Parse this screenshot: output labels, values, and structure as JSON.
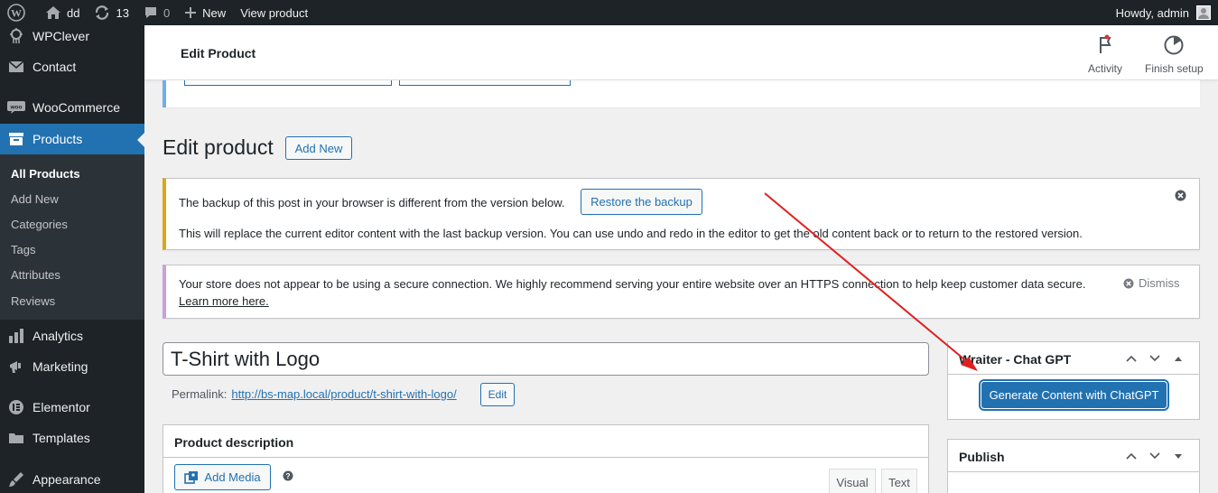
{
  "adminbar": {
    "site_name": "dd",
    "updates_count": "13",
    "comments_count": "0",
    "new_label": "New",
    "view_product_label": "View product",
    "howdy_label": "Howdy, admin"
  },
  "sidebar": {
    "items": [
      {
        "label": "WPClever",
        "icon": "wpclever-icon"
      },
      {
        "label": "Contact",
        "icon": "envelope-icon"
      },
      {
        "label": "WooCommerce",
        "icon": "woocommerce-icon"
      },
      {
        "label": "Products",
        "icon": "archive-box-icon"
      },
      {
        "label": "Analytics",
        "icon": "bar-chart-icon"
      },
      {
        "label": "Marketing",
        "icon": "megaphone-icon"
      },
      {
        "label": "Elementor",
        "icon": "elementor-icon"
      },
      {
        "label": "Templates",
        "icon": "folder-icon"
      },
      {
        "label": "Appearance",
        "icon": "paintbrush-icon"
      }
    ],
    "submenu": [
      "All Products",
      "Add New",
      "Categories",
      "Tags",
      "Attributes",
      "Reviews"
    ]
  },
  "header": {
    "title": "Edit Product",
    "activity_label": "Activity",
    "finish_setup_label": "Finish setup"
  },
  "main": {
    "page_title": "Edit product",
    "add_new_label": "Add New",
    "backup_notice": {
      "line1": "The backup of this post in your browser is different from the version below.",
      "restore_label": "Restore the backup",
      "line2": "This will replace the current editor content with the last backup version. You can use undo and redo in the editor to get the old content back or to return to the restored version."
    },
    "ssl_notice": {
      "text": "Your store does not appear to be using a secure connection. We highly recommend serving your entire website over an HTTPS connection to help keep customer data secure.",
      "link": "Learn more here.",
      "dismiss": "Dismiss"
    },
    "product_title": "T-Shirt with Logo",
    "permalink_label": "Permalink:",
    "permalink_url": "http://bs-map.local/product/t-shirt-with-logo/",
    "permalink_edit": "Edit",
    "description_box": {
      "title": "Product description",
      "add_media_label": "Add Media",
      "tab_visual": "Visual",
      "tab_text": "Text"
    }
  },
  "side": {
    "wraiter_box": {
      "title": "Wraiter - Chat GPT",
      "generate_label": "Generate Content with ChatGPT"
    },
    "publish_box": {
      "title": "Publish"
    }
  },
  "colors": {
    "admin_dark": "#1d2327",
    "accent_blue": "#2271b1",
    "warning_border": "#dba617",
    "woo_notice_border": "#c9a0d8",
    "annotation_arrow": "#e02020"
  }
}
